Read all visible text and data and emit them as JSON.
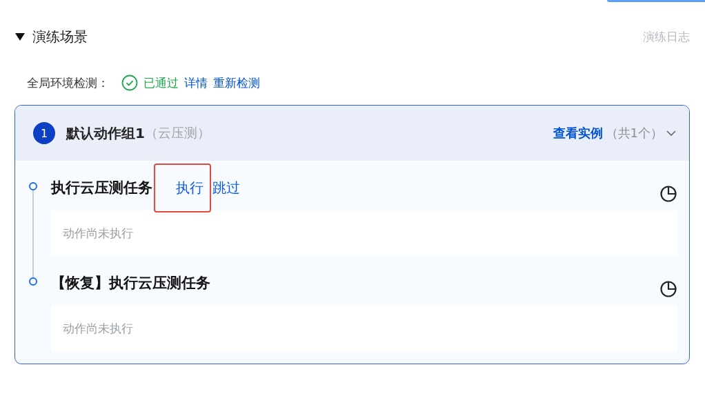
{
  "section": {
    "title": "演练场景",
    "expanded": true,
    "log_link": "演练日志"
  },
  "env_check": {
    "label": "全局环境检测：",
    "status": "已通过",
    "passed": true,
    "links": [
      "详情",
      "重新检测"
    ]
  },
  "group": {
    "index": "1",
    "name": "默认动作组1",
    "type": "（云压测）",
    "view_link": "查看实例",
    "count": "（共1个）",
    "expanded": false,
    "steps": [
      {
        "title": "执行云压测任务",
        "actions": [
          {
            "label": "执行",
            "highlighted": true
          },
          {
            "label": "跳过",
            "highlighted": false
          }
        ],
        "message": "动作尚未执行"
      },
      {
        "title": "【恢复】执行云压测任务",
        "message": "动作尚未执行"
      }
    ]
  }
}
